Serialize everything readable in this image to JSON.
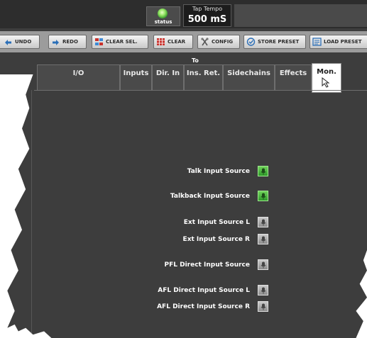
{
  "status": {
    "label": "status"
  },
  "tap_tempo": {
    "title": "Tap Tempo",
    "value": "500 mS"
  },
  "toolbar": {
    "undo": "UNDO",
    "redo": "REDO",
    "clear_sel": "CLEAR SEL.",
    "clear": "CLEAR",
    "config": "CONFIG",
    "store_preset": "STORE PRESET",
    "load_preset": "LOAD PRESET"
  },
  "header": {
    "to_label": "To"
  },
  "tabs": [
    {
      "label": "I/O"
    },
    {
      "label": "Inputs"
    },
    {
      "label": "Dir. In"
    },
    {
      "label": "Ins. Ret."
    },
    {
      "label": "Sidechains"
    },
    {
      "label": "Effects"
    },
    {
      "label": "Mon.",
      "active": true
    }
  ],
  "rows": [
    {
      "label": "Talk Input Source",
      "state": "on"
    },
    {
      "label": "Talkback Input Source",
      "state": "on"
    },
    {
      "label": "Ext Input Source L",
      "state": "off"
    },
    {
      "label": "Ext Input Source R",
      "state": "off"
    },
    {
      "label": "PFL Direct Input Source",
      "state": "off"
    },
    {
      "label": "AFL Direct Input Source L",
      "state": "off"
    },
    {
      "label": "AFL Direct Input Source R",
      "state": "off"
    }
  ],
  "colors": {
    "panel": "#3d3d3d",
    "toolbar": "#9c9c9c",
    "on": "#3fae34",
    "off": "#a8a8a8",
    "status_led": "#9be86a"
  }
}
